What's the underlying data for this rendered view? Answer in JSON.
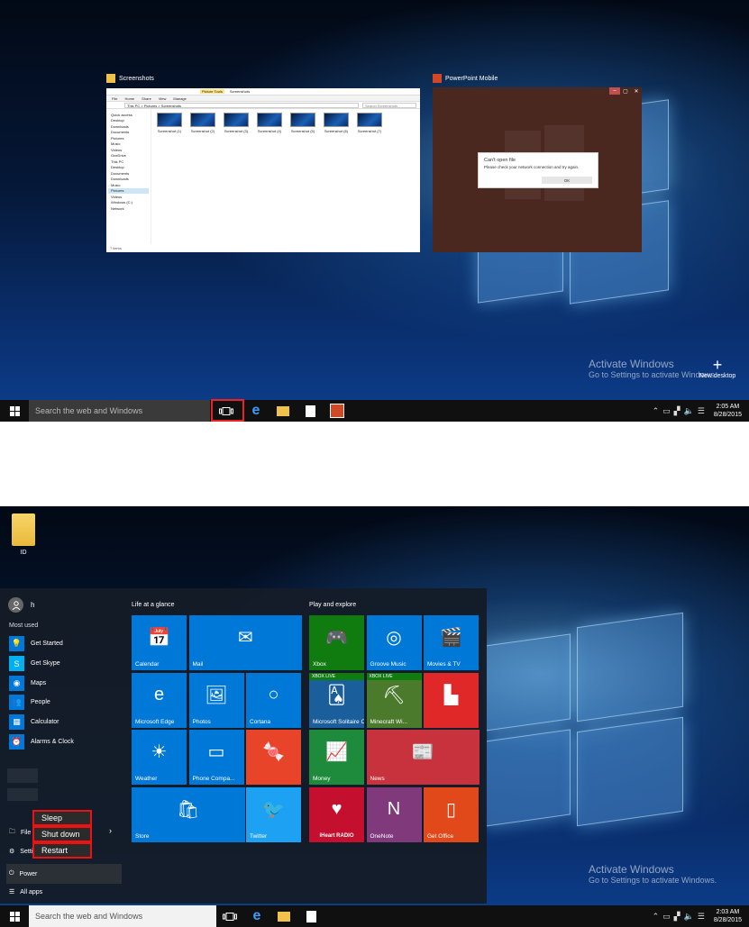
{
  "shot1": {
    "explorer_title": "Screenshots",
    "ppt_title": "PowerPoint Mobile",
    "explorer": {
      "tabs": [
        "File",
        "Home",
        "Share",
        "View",
        "Manage"
      ],
      "picture_tools": "Picture Tools",
      "ribbon_title": "Screenshots",
      "address": "This PC > Pictures > Screenshots",
      "search_placeholder": "Search Screenshots",
      "nav": [
        "Quick access",
        "Desktop",
        "Downloads",
        "Documents",
        "Pictures",
        "Music",
        "Videos",
        "OneDrive",
        "This PC",
        "Desktop",
        "Documents",
        "Downloads",
        "Music",
        "Pictures",
        "Videos",
        "Windows (C:)",
        "Network"
      ],
      "files": [
        "Screenshot (1)",
        "Screenshot (2)",
        "Screenshot (3)",
        "Screenshot (4)",
        "Screenshot (5)",
        "Screenshot (6)",
        "Screenshot (7)"
      ],
      "status": "7 items"
    },
    "dialog": {
      "title": "Can't open file",
      "message": "Please check your network connection and try again.",
      "ok": "OK"
    },
    "activate_title": "Activate Windows",
    "activate_sub": "Go to Settings to activate Windows.",
    "new_desktop": "New desktop",
    "search_placeholder": "Search the web and Windows",
    "time": "2:05 AM",
    "date": "8/28/2015"
  },
  "shot2": {
    "desktop_icon_label": "ID",
    "user_name": "h",
    "most_used_label": "Most used",
    "most_used": [
      {
        "label": "Get Started",
        "icon": "lightbulb-icon",
        "glyph": "💡",
        "color": "#0078d7"
      },
      {
        "label": "Get Skype",
        "icon": "skype-icon",
        "glyph": "S",
        "color": "#00aff0"
      },
      {
        "label": "Maps",
        "icon": "maps-icon",
        "glyph": "◉",
        "color": "#0078d7"
      },
      {
        "label": "People",
        "icon": "people-icon",
        "glyph": "👥",
        "color": "#0078d7"
      },
      {
        "label": "Calculator",
        "icon": "calculator-icon",
        "glyph": "▦",
        "color": "#0078d7"
      },
      {
        "label": "Alarms & Clock",
        "icon": "alarm-icon",
        "glyph": "⏰",
        "color": "#0078d7"
      }
    ],
    "file_explorer": "File E",
    "settings": "Setti",
    "power": "Power",
    "all_apps": "All apps",
    "power_menu": [
      "Sleep",
      "Shut down",
      "Restart"
    ],
    "group1_title": "Life at a glance",
    "group2_title": "Play and explore",
    "tiles": [
      {
        "label": "Calendar",
        "icon": "calendar-icon",
        "glyph": "📅",
        "color": "#0078d7"
      },
      {
        "label": "Mail",
        "icon": "mail-icon",
        "glyph": "✉",
        "color": "#0078d7"
      },
      {
        "label": "Microsoft Edge",
        "icon": "edge-icon",
        "glyph": "e",
        "color": "#0078d7"
      },
      {
        "label": "Photos",
        "icon": "photos-icon",
        "glyph": "🖼",
        "color": "#0078d7"
      },
      {
        "label": "Cortana",
        "icon": "cortana-icon",
        "glyph": "○",
        "color": "#0078d7"
      },
      {
        "label": "Weather",
        "icon": "weather-icon",
        "glyph": "☀",
        "color": "#0078d7"
      },
      {
        "label": "Phone Compa...",
        "icon": "phone-icon",
        "glyph": "▭",
        "color": "#0078d7"
      },
      {
        "label": "",
        "icon": "candy-crush-icon",
        "glyph": "🍬",
        "color": "#e8442a"
      },
      {
        "label": "Store",
        "icon": "store-icon",
        "glyph": "🛍",
        "color": "#0078d7"
      },
      {
        "label": "Twitter",
        "icon": "twitter-icon",
        "glyph": "🐦",
        "color": "#1da1f2"
      },
      {
        "label": "Xbox",
        "icon": "xbox-icon",
        "glyph": "🎮",
        "color": "#107c10"
      },
      {
        "label": "Groove Music",
        "icon": "groove-icon",
        "glyph": "◎",
        "color": "#0078d7"
      },
      {
        "label": "Movies & TV",
        "icon": "movies-icon",
        "glyph": "🎬",
        "color": "#0078d7"
      },
      {
        "label": "Microsoft Solitaire Collection",
        "icon": "solitaire-icon",
        "glyph": "🂡",
        "color": "#1a5f9c"
      },
      {
        "label": "Minecraft Wi...",
        "icon": "minecraft-icon",
        "glyph": "⛏",
        "color": "#4b7a2c"
      },
      {
        "label": "",
        "icon": "flipboard-icon",
        "glyph": "▙",
        "color": "#e12828"
      },
      {
        "label": "Money",
        "icon": "money-icon",
        "glyph": "📈",
        "color": "#1e8a3c"
      },
      {
        "label": "News",
        "icon": "news-icon",
        "glyph": "📰",
        "color": "#c8323c"
      },
      {
        "label": "",
        "icon": "iheart-icon",
        "glyph": "♥",
        "color": "#c4102e"
      },
      {
        "label": "OneNote",
        "icon": "onenote-icon",
        "glyph": "N",
        "color": "#80397b"
      },
      {
        "label": "Get Office",
        "icon": "office-icon",
        "glyph": "▯",
        "color": "#e2491a"
      }
    ],
    "xbox_live": "XBOX LIVE",
    "iheart_text": "iHeart RADIO",
    "activate_title": "Activate Windows",
    "activate_sub": "Go to Settings to activate Windows.",
    "search_placeholder": "Search the web and Windows",
    "time": "2:03 AM",
    "date": "8/28/2015"
  },
  "colors": {
    "taskbar": "#101010",
    "accent": "#0078d7",
    "highlight": "#e22222"
  }
}
